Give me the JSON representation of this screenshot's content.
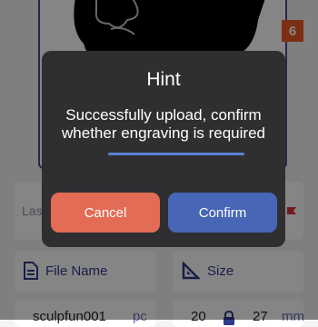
{
  "badge": {
    "value": "6"
  },
  "laser": {
    "label": "Las"
  },
  "fields": {
    "file_name": {
      "label": "File Name",
      "value": "sculpfun001",
      "unit": "pc"
    },
    "size": {
      "label": "Size",
      "width": "20",
      "height": "27",
      "unit": "mm"
    }
  },
  "dialog": {
    "title": "Hint",
    "message": "Successfully upload, confirm whether engraving is required",
    "progress": 1.0,
    "cancel_label": "Cancel",
    "confirm_label": "Confirm"
  },
  "colors": {
    "badge": "#f05a2a",
    "cancel": "#e26c55",
    "confirm": "#4766b6",
    "accent": "#2e3a8a"
  },
  "icons": {
    "file": "file-icon",
    "size": "ruler-triangle-icon",
    "lock": "lock-icon"
  }
}
